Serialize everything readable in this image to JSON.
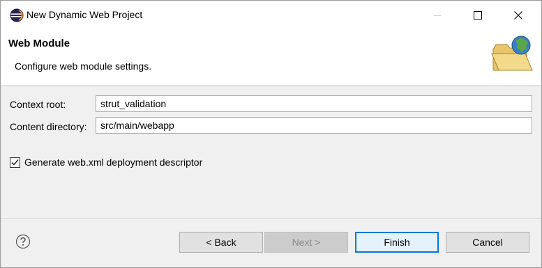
{
  "window": {
    "title": "New Dynamic Web Project",
    "controls": {
      "minimize_icon": "minimize-icon",
      "maximize_icon": "maximize-icon",
      "close_icon": "close-icon"
    }
  },
  "banner": {
    "title": "Web Module",
    "description": "Configure web module settings.",
    "icon": "web-folder-globe-icon"
  },
  "form": {
    "context_root": {
      "label": "Context root:",
      "value": "strut_validation"
    },
    "content_directory": {
      "label": "Content directory:",
      "value": "src/main/webapp"
    },
    "generate_web_xml": {
      "label": "Generate web.xml deployment descriptor",
      "checked": true
    }
  },
  "footer": {
    "help_icon": "help-icon",
    "back_label": "< Back",
    "next_label": "Next >",
    "finish_label": "Finish",
    "cancel_label": "Cancel"
  },
  "colors": {
    "accent": "#0078d7",
    "dialog_bg": "#f0f0f0",
    "banner_bg": "#ffffff",
    "button_bg": "#e1e1e1",
    "disabled_button_bg": "#cccccc"
  }
}
